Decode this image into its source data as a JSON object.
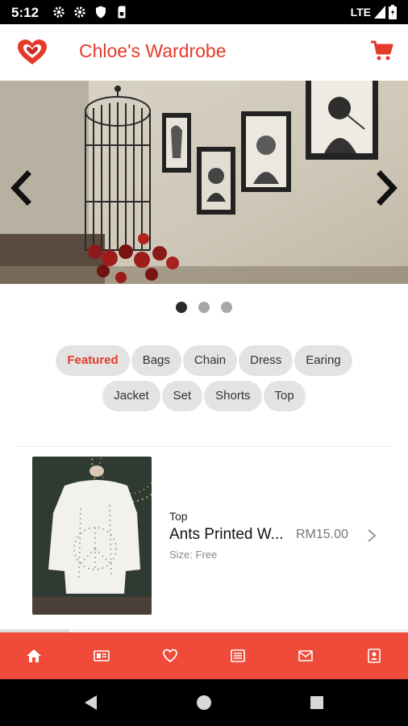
{
  "status_bar": {
    "time": "5:12",
    "network": "LTE",
    "icons": [
      "settings-icon",
      "settings-icon",
      "shield-icon",
      "sim-card-icon",
      "signal-icon",
      "battery-icon"
    ]
  },
  "app_bar": {
    "title": "Chloe's Wardrobe",
    "logo_icon": "heart-logo-icon",
    "cart_icon": "cart-icon",
    "accent_color": "#e53a2a"
  },
  "carousel": {
    "slide_count": 3,
    "active_index": 0,
    "prev_icon": "chevron-left-icon",
    "next_icon": "chevron-right-icon"
  },
  "categories": [
    {
      "label": "Featured",
      "active": true
    },
    {
      "label": "Bags",
      "active": false
    },
    {
      "label": "Chain",
      "active": false
    },
    {
      "label": "Dress",
      "active": false
    },
    {
      "label": "Earing",
      "active": false
    },
    {
      "label": "Jacket",
      "active": false
    },
    {
      "label": "Set",
      "active": false
    },
    {
      "label": "Shorts",
      "active": false
    },
    {
      "label": "Top",
      "active": false
    }
  ],
  "products": [
    {
      "category": "Top",
      "name": "Ants Printed White Top",
      "name_display": "Ants Printed W...",
      "size": "Size: Free",
      "price": "RM15.00"
    }
  ],
  "bottom_nav": {
    "color": "#ef4a3a",
    "items": [
      "home-icon",
      "catalog-icon",
      "heart-icon",
      "news-icon",
      "mail-icon",
      "contact-icon"
    ]
  },
  "system_nav": [
    "back-icon",
    "home-button-icon",
    "recents-icon"
  ]
}
